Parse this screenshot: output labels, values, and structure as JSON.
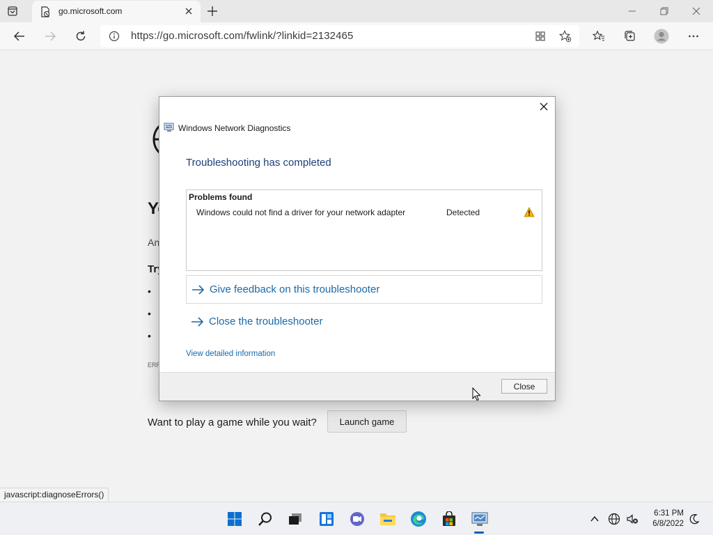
{
  "browser": {
    "tab_title": "go.microsoft.com",
    "address": "https://go.microsoft.com/fwlink/?linkid=2132465"
  },
  "page": {
    "heading_partial": "Yo",
    "line_partial": "An",
    "try_partial": "Try",
    "bullets": [
      "•",
      "•",
      "•"
    ],
    "error_partial": "ERR",
    "game_prompt": "Want to play a game while you wait?",
    "launch_label": "Launch game"
  },
  "status_bar": {
    "text": "javascript:diagnoseErrors()"
  },
  "dialog": {
    "title": "Windows Network Diagnostics",
    "heading": "Troubleshooting has completed",
    "problems_header": "Problems found",
    "problems": [
      {
        "description": "Windows could not find a driver for your network adapter",
        "status": "Detected",
        "icon": "warning-icon"
      }
    ],
    "actions": [
      {
        "label": "Give feedback on this troubleshooter",
        "icon": "arrow-right-icon"
      },
      {
        "label": "Close the troubleshooter",
        "icon": "arrow-right-icon"
      }
    ],
    "detail_link": "View detailed information",
    "close_label": "Close"
  },
  "taskbar": {
    "time": "6:31 PM",
    "date": "6/8/2022"
  },
  "colors": {
    "accent": "#005fb8",
    "dialog_heading": "#1a3e7a",
    "link": "#1a6aa8",
    "warning": "#f2b300"
  }
}
